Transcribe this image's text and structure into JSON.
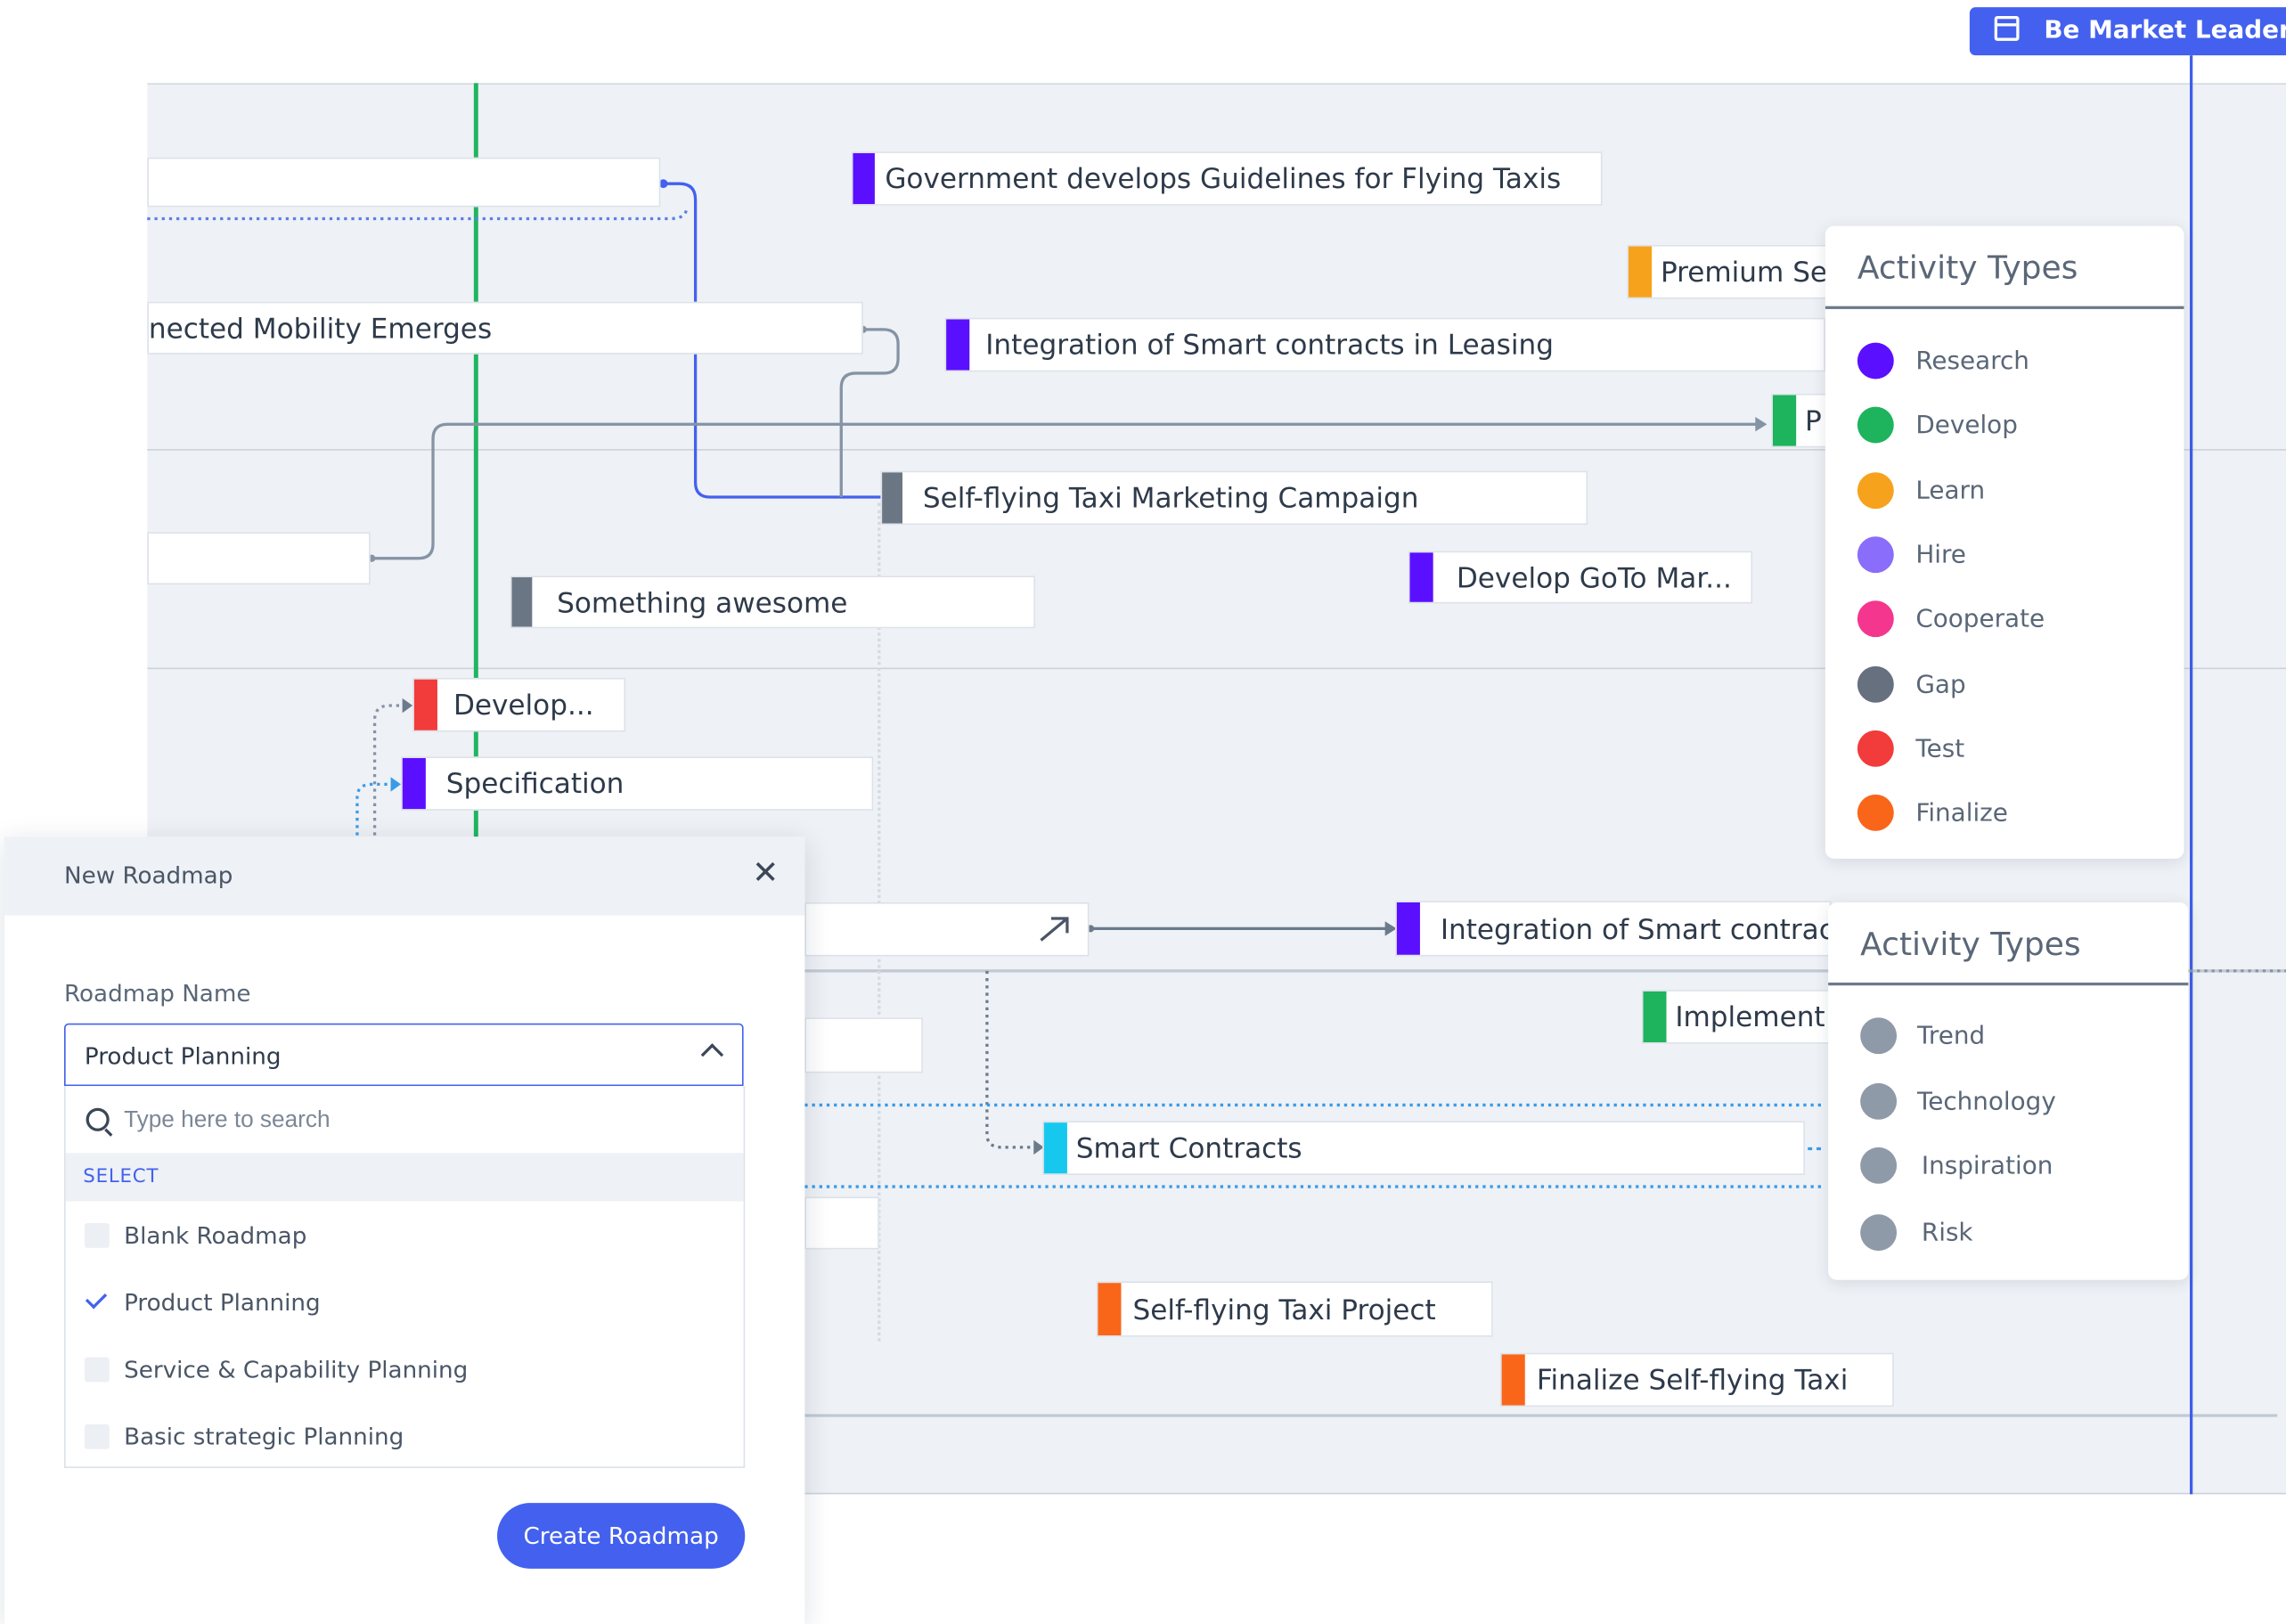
{
  "milestone": {
    "label": "Be Market Leader i",
    "icon": "calendar-icon"
  },
  "cards": [
    {
      "name": "card-blank-1",
      "text": "",
      "color": "#ffffff"
    },
    {
      "name": "card-government-guidelines",
      "text": "Government develops Guidelines for Flying Taxis",
      "color": "#5b0fff"
    },
    {
      "name": "card-premium",
      "text": "Premium Se",
      "color": "#f7a21c"
    },
    {
      "name": "card-connected-mobility",
      "text": "nected Mobility Emerges",
      "color": "#ffffff"
    },
    {
      "name": "card-smart-contracts-leasing",
      "text": "Integration of Smart contracts in Leasing",
      "color": "#5b0fff"
    },
    {
      "name": "card-p",
      "text": "P",
      "color": "#1db45d"
    },
    {
      "name": "card-blank-2",
      "text": "",
      "color": "#ffffff"
    },
    {
      "name": "card-marketing-campaign",
      "text": "Self-flying Taxi Marketing Campaign",
      "color": "#6b7685"
    },
    {
      "name": "card-develop-goto",
      "text": "Develop GoTo Mar...",
      "color": "#5b0fff"
    },
    {
      "name": "card-something-awesome",
      "text": "Something awesome",
      "color": "#6b7685"
    },
    {
      "name": "card-develop",
      "text": "Develop...",
      "color": "#f23b3b"
    },
    {
      "name": "card-specification",
      "text": "Specification",
      "color": "#5b0fff"
    },
    {
      "name": "card-blank-3",
      "text": "",
      "color": "#ffffff"
    },
    {
      "name": "card-integration-smart-contrac",
      "text": "Integration of Smart contrac",
      "color": "#5b0fff"
    },
    {
      "name": "card-implement",
      "text": "Implement",
      "color": "#1db45d"
    },
    {
      "name": "card-blank-4",
      "text": "",
      "color": "#ffffff"
    },
    {
      "name": "card-smart-contracts",
      "text": "Smart Contracts",
      "color": "#16c8ee"
    },
    {
      "name": "card-blank-5",
      "text": "",
      "color": "#ffffff"
    },
    {
      "name": "card-taxi-project",
      "text": "Self-flying Taxi Project",
      "color": "#f9661a"
    },
    {
      "name": "card-finalize-taxi",
      "text": "Finalize Self-flying Taxi",
      "color": "#f9661a"
    }
  ],
  "legend_activity": {
    "title": "Activity Types",
    "items": [
      {
        "label": "Research",
        "color": "#5b0fff"
      },
      {
        "label": "Develop",
        "color": "#1db45d"
      },
      {
        "label": "Learn",
        "color": "#f7a21c"
      },
      {
        "label": "Hire",
        "color": "#8a6dfa"
      },
      {
        "label": "Cooperate",
        "color": "#f4368f"
      },
      {
        "label": "Gap",
        "color": "#66707f"
      },
      {
        "label": "Test",
        "color": "#f23b3b"
      },
      {
        "label": "Finalize",
        "color": "#f9661a"
      }
    ]
  },
  "legend_types": {
    "title": "Activity Types",
    "items": [
      {
        "label": "Trend",
        "icon": "trend-icon"
      },
      {
        "label": "Technology",
        "icon": "technology-icon"
      },
      {
        "label": "Inspiration",
        "icon": "inspiration-icon"
      },
      {
        "label": "Risk",
        "icon": "risk-icon"
      }
    ]
  },
  "dialog": {
    "title": "New Roadmap",
    "close_icon": "close-icon",
    "field_label": "Roadmap Name",
    "selected_value": "Product Planning",
    "search_placeholder": "Type here to search",
    "section_label": "SELECT",
    "options": [
      {
        "label": "Blank Roadmap",
        "checked": false
      },
      {
        "label": "Product Planning",
        "checked": true
      },
      {
        "label": "Service & Capability Planning",
        "checked": false
      },
      {
        "label": "Basic strategic Planning",
        "checked": false
      }
    ],
    "submit_label": "Create Roadmap"
  }
}
